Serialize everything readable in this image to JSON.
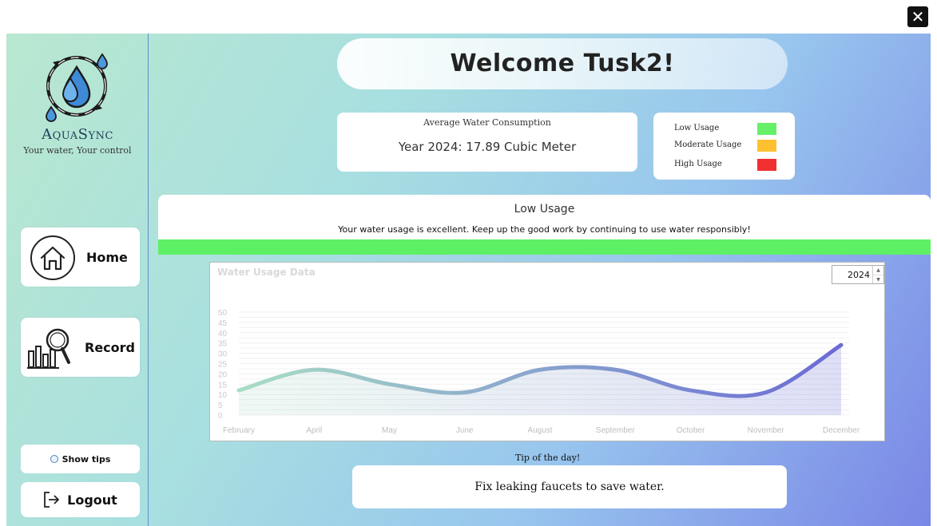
{
  "window": {
    "close_glyph": "✕"
  },
  "sidebar": {
    "brand": "AquaSync",
    "tagline": "Your water, Your control",
    "nav": [
      {
        "label": "Home",
        "icon": "home-icon"
      },
      {
        "label": "Record",
        "icon": "chart-search-icon"
      }
    ],
    "show_tips_label": "Show tips",
    "logout_label": "Logout",
    "logout_icon": "logout-arrow-icon"
  },
  "header": {
    "welcome": "Welcome Tusk2!"
  },
  "average": {
    "title": "Average Water Consumption",
    "value": "Year 2024: 17.89 Cubic Meter"
  },
  "legend": [
    {
      "label": "Low Usage",
      "color": "#66f06a"
    },
    {
      "label": "Moderate Usage",
      "color": "#ffc130"
    },
    {
      "label": "High Usage",
      "color": "#f03030"
    }
  ],
  "status": {
    "title": "Low Usage",
    "message": "Your water usage is excellent. Keep up the good work by continuing to use water responsibly!",
    "bar_color": "#5ef064",
    "bar_fill": 1.0
  },
  "chart": {
    "title": "Water Usage Data",
    "year": "2024"
  },
  "chart_data": {
    "type": "area",
    "title": "Water Usage Data",
    "categories": [
      "February",
      "April",
      "May",
      "June",
      "August",
      "September",
      "October",
      "November",
      "December"
    ],
    "values": [
      12,
      22,
      15,
      11,
      22,
      22,
      12,
      11,
      34
    ],
    "yticks": [
      0,
      5,
      10,
      15,
      20,
      25,
      30,
      35,
      40,
      45,
      50
    ],
    "ylim": [
      0,
      50
    ],
    "smooth": true,
    "gradient": [
      "#a8ddc4",
      "#6a6ad6"
    ],
    "grid": true,
    "legend": "none"
  },
  "tip": {
    "label": "Tip of the day!",
    "text": "Fix leaking faucets to save water."
  }
}
